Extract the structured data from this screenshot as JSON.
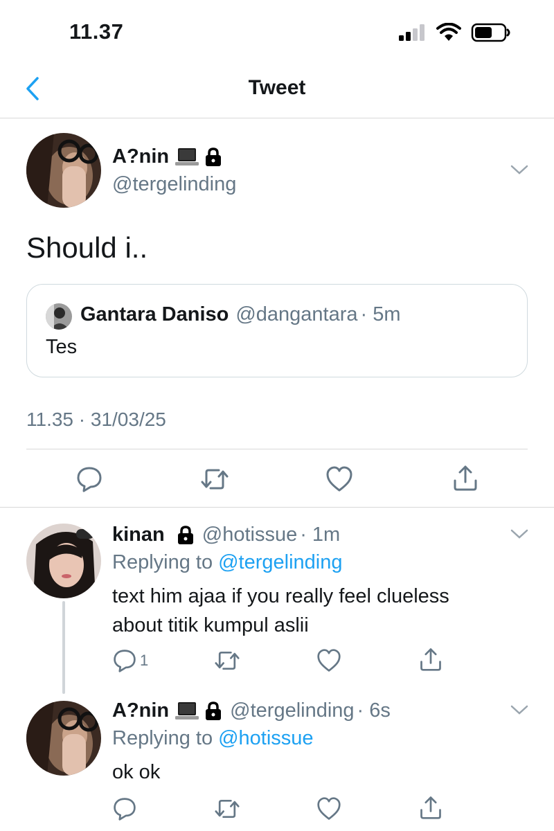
{
  "status_bar": {
    "time": "11.37"
  },
  "nav": {
    "title": "Tweet"
  },
  "main_tweet": {
    "name": "A?nin",
    "handle": "@tergelinding",
    "text": "Should i..",
    "timestamp": "11.35 · 31/03/25",
    "quoted": {
      "name": "Gantara Daniso",
      "handle": "@dangantara",
      "time": "· 5m",
      "text": "Tes"
    }
  },
  "replies": [
    {
      "name": "kinan",
      "handle": "@hotissue",
      "time": "· 1m",
      "replying_prefix": "Replying to",
      "replying_to": "@tergelinding",
      "text_lines": [
        "text him ajaa if you really feel clueless",
        "about titik kumpul aslii"
      ],
      "reply_count": "1"
    },
    {
      "name": "A?nin",
      "handle": "@tergelinding",
      "time": "· 6s",
      "replying_prefix": "Replying to",
      "replying_to": "@hotissue",
      "text_lines": [
        "ok ok"
      ]
    }
  ],
  "colors": {
    "accent": "#1da1f2",
    "muted": "#657786",
    "text": "#14171a",
    "divider": "#d8d8d8"
  },
  "icons": {
    "back": "chevron-left-icon",
    "more": "chevron-down-icon",
    "reply": "reply-icon",
    "retweet": "retweet-icon",
    "like": "heart-icon",
    "share": "share-icon",
    "laptop": "laptop-icon",
    "lock": "lock-icon"
  }
}
